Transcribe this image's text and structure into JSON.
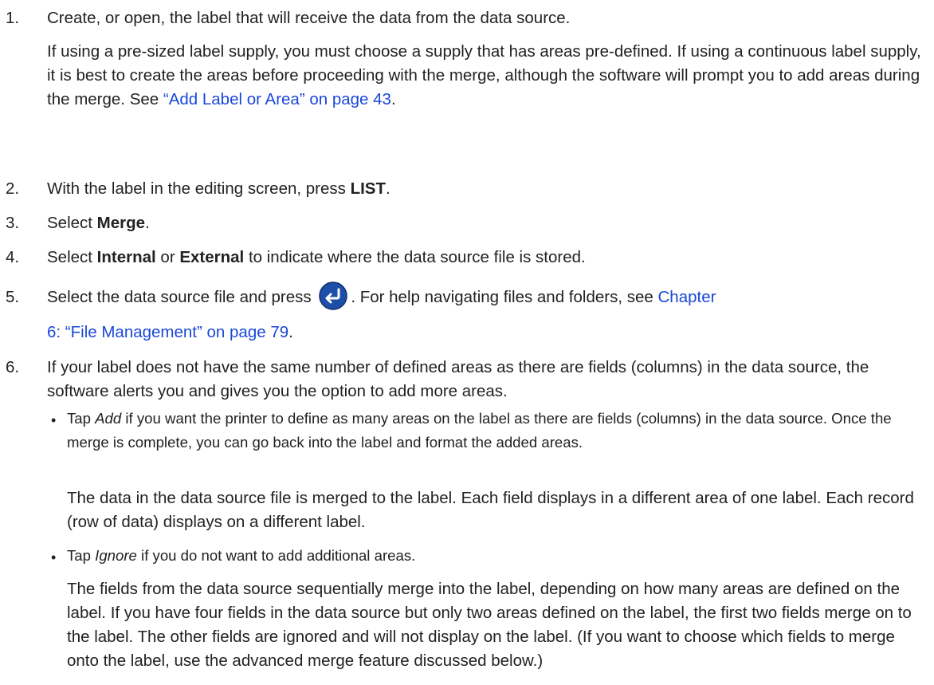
{
  "steps": [
    {
      "num": "1.",
      "text": "Create, or open, the label that will receive the data from the data source.",
      "detail_pre": "If using a pre-sized label supply, you must choose a supply that has areas pre-defined. If using a continuous label supply, it is best to create the areas before proceeding with the merge, although the software will prompt you to add areas during the merge. See ",
      "detail_link": "“Add Label or Area” on page 43",
      "detail_post": "."
    },
    {
      "num": "2.",
      "pre": "With the label in the editing screen, press ",
      "bold": "LIST",
      "post": "."
    },
    {
      "num": "3.",
      "pre": "Select ",
      "bold": "Merge",
      "post": "."
    },
    {
      "num": "4.",
      "pre": "Select ",
      "bold1": "Internal",
      "mid": " or ",
      "bold2": "External",
      "post": " to indicate where the data source file is stored."
    },
    {
      "num": "5.",
      "pre": "Select the data source file and press ",
      "icon": "enter-key-icon",
      "post": ". For help navigating files and folders, see ",
      "link_line1": "Chapter",
      "link_line2": "6: “File Management” on page 79",
      "end": "."
    },
    {
      "num": "6.",
      "text": "If your label does not have the same number of defined areas as there are fields (columns) in the data source, the software alerts you and gives you the option to add more areas.",
      "bullets": [
        {
          "pre": "Tap ",
          "italic": "Add",
          "post": " if you want the printer to define as many areas on the label as there are fields (columns) in the data source. Once the merge is complete, you can go back into the label and format the added areas.",
          "follow": "The data in the data source file is merged to the label. Each field displays in a different area of one label. Each record (row of data) displays on a different label."
        },
        {
          "pre": "Tap ",
          "italic": "Ignore",
          "post": " if you do not want to add additional areas.",
          "follow": "The fields from the data source sequentially merge into the label, depending on how many areas are defined on the label. If you have four fields in the data source but only two areas defined on the label, the first two fields merge on to the label. The other fields are ignored and will not display on the label. (If you want to choose which fields to merge onto the label, use the advanced merge feature discussed below.)"
        }
      ]
    }
  ],
  "colors": {
    "text": "#222222",
    "link": "#1a48d8",
    "icon_fill": "#1d4fa8"
  }
}
